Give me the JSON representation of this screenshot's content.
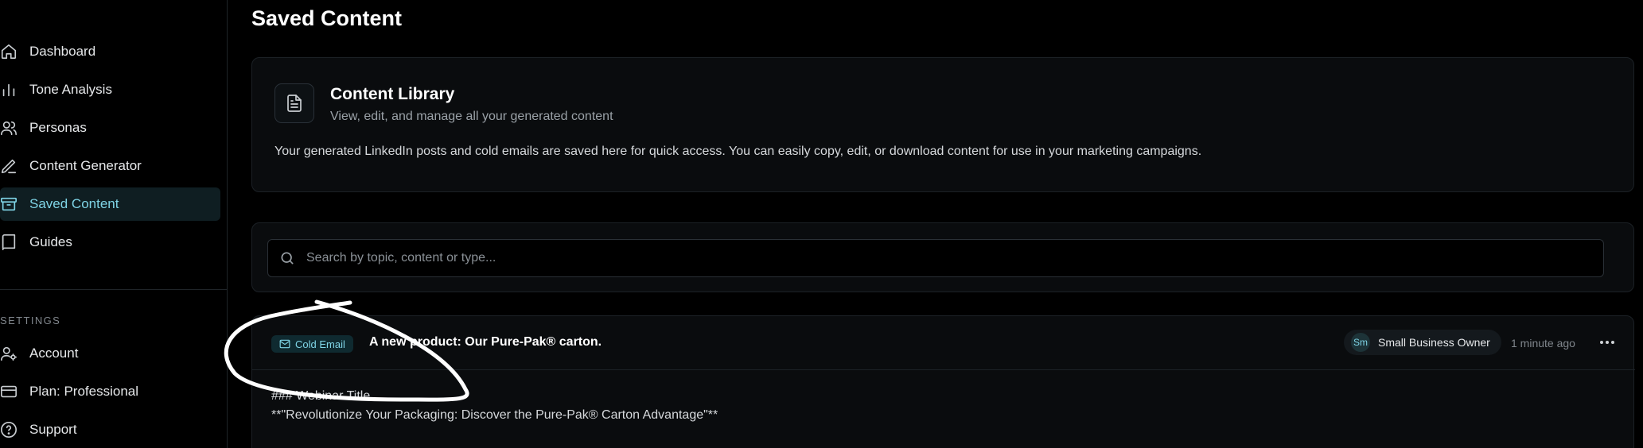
{
  "page": {
    "title": "Saved Content"
  },
  "sidebar": {
    "items": [
      {
        "label": "Dashboard",
        "icon": "home-icon"
      },
      {
        "label": "Tone Analysis",
        "icon": "bar-chart-icon"
      },
      {
        "label": "Personas",
        "icon": "users-icon"
      },
      {
        "label": "Content Generator",
        "icon": "pen-icon"
      },
      {
        "label": "Saved Content",
        "icon": "archive-icon",
        "active": true
      },
      {
        "label": "Guides",
        "icon": "book-icon"
      }
    ],
    "settings_heading": "SETTINGS",
    "settings_items": [
      {
        "label": "Account",
        "icon": "user-gear-icon"
      },
      {
        "label": "Plan: Professional",
        "icon": "credit-card-icon"
      },
      {
        "label": "Support",
        "icon": "help-circle-icon"
      }
    ]
  },
  "library": {
    "title": "Content Library",
    "subtitle": "View, edit, and manage all your generated content",
    "description": "Your generated LinkedIn posts and cold emails are saved here for quick access. You can easily copy, edit, or download content for use in your marketing campaigns.",
    "icon": "document-icon"
  },
  "search": {
    "placeholder": "Search by topic, content or type...",
    "value": ""
  },
  "item": {
    "type": "Cold Email",
    "title": "A new product: Our Pure-Pak® carton.",
    "persona_initials": "Sm",
    "persona": "Small Business Owner",
    "timestamp": "1 minute ago",
    "line1": "### Webinar Title",
    "line2": "**\"Revolutionize Your Packaging: Discover the Pure-Pak® Carton Advantage\"**"
  },
  "colors": {
    "accent": "#7fd4e6",
    "background": "#000000",
    "card": "#0a0c0e"
  }
}
